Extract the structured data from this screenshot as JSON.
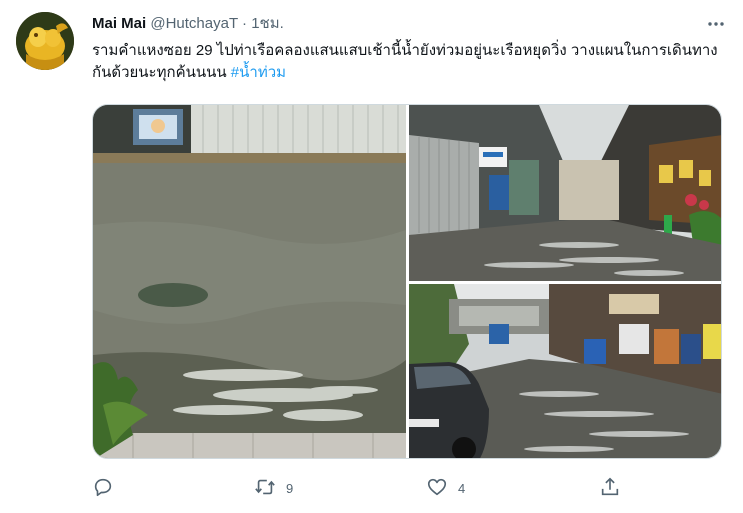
{
  "author": {
    "display_name": "Mai Mai",
    "handle": "@HutchayaT",
    "separator": "·",
    "time": "1ชม."
  },
  "tweet": {
    "text": "รามคำแหงซอย 29 ไปท่าเรือคลองแสนแสบเช้านี้น้ำยังท่วมอยู่นะเรือหยุดวิ่ง วางแผนในการเดินทางกันด้วยนะทุกค้นนนน ",
    "hashtag": "#น้ำท่วม"
  },
  "media": {
    "photos": [
      {
        "subject": "flooded-sidewalk"
      },
      {
        "subject": "flooded-alley"
      },
      {
        "subject": "flooded-street-with-car"
      }
    ]
  },
  "actions": {
    "reply": {
      "icon": "reply-icon",
      "count": ""
    },
    "retweet": {
      "icon": "retweet-icon",
      "count": "9"
    },
    "like": {
      "icon": "heart-icon",
      "count": "4"
    },
    "share": {
      "icon": "share-icon",
      "count": ""
    }
  },
  "colors": {
    "text": "#0f1419",
    "secondary": "#536471",
    "link": "#1d9bf0",
    "border": "#cfd9de"
  }
}
